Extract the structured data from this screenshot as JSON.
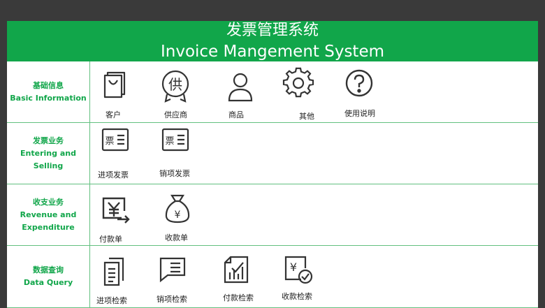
{
  "header": {
    "title_cn": "发票管理系统",
    "title_en": "Invoice Mangement System"
  },
  "sections": [
    {
      "title_cn": "基础信息",
      "title_en": "Basic Information",
      "items": [
        {
          "label": "客户",
          "icon": "shopping-bag-icon"
        },
        {
          "label": "供应商",
          "icon": "supplier-badge-icon"
        },
        {
          "label": "商品",
          "icon": "person-icon"
        },
        {
          "label": "其他",
          "icon": "gear-icon"
        },
        {
          "label": "使用说明",
          "icon": "question-icon"
        }
      ]
    },
    {
      "title_cn": "发票业务",
      "title_en": "Entering and Selling",
      "items": [
        {
          "label": "进项发票",
          "icon": "invoice-icon"
        },
        {
          "label": "销项发票",
          "icon": "invoice-icon"
        }
      ]
    },
    {
      "title_cn": "收支业务",
      "title_en_line1": "Revenue and",
      "title_en_line2": "Expenditure",
      "items": [
        {
          "label": "付款单",
          "icon": "yuan-payment-icon"
        },
        {
          "label": "收款单",
          "icon": "money-bag-icon"
        }
      ]
    },
    {
      "title_cn": "数据查询",
      "title_en": "Data Query",
      "items": [
        {
          "label": "进项检索",
          "icon": "documents-icon"
        },
        {
          "label": "销项检索",
          "icon": "list-bubble-icon"
        },
        {
          "label": "付款检索",
          "icon": "chart-check-icon"
        },
        {
          "label": "收款检索",
          "icon": "yuan-check-icon"
        }
      ]
    }
  ],
  "colors": {
    "accent": "#11a64a",
    "divider": "#62c07f",
    "icon": "#333333",
    "backdrop": "#3a3a3a"
  }
}
